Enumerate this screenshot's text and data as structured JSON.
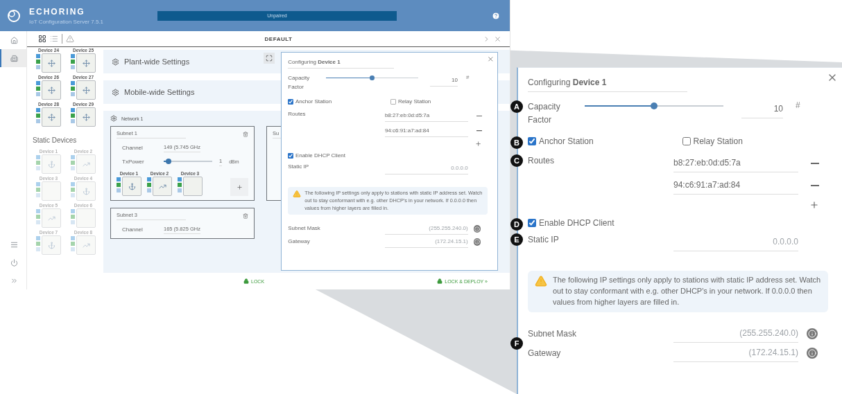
{
  "header": {
    "brand": "ECHORING",
    "subtitle": "IoT Configuration Server 7.5.1",
    "status": "Unpaired"
  },
  "nav": {
    "top": [
      {
        "kind": "home",
        "selected": false
      },
      {
        "kind": "building",
        "selected": true
      }
    ],
    "bottom": [
      {
        "kind": "list"
      },
      {
        "kind": "power"
      },
      {
        "kind": "expand"
      }
    ]
  },
  "toolbar": {
    "views": [
      {
        "kind": "grid",
        "selected": true
      },
      {
        "kind": "list",
        "selected": false
      }
    ],
    "title": "DEFAULT"
  },
  "palette": {
    "devices": [
      {
        "name": "Device 24",
        "kind": "move"
      },
      {
        "name": "Device 25",
        "kind": "move"
      },
      {
        "name": "Device 26",
        "kind": "move"
      },
      {
        "name": "Device 27",
        "kind": "move"
      },
      {
        "name": "Device 28",
        "kind": "move"
      },
      {
        "name": "Device 29",
        "kind": "move"
      }
    ],
    "static_title": "Static Devices",
    "static_devices": [
      {
        "name": "Device 1",
        "kind": "anchor"
      },
      {
        "name": "Device 2",
        "kind": "chart"
      },
      {
        "name": "Device 3",
        "kind": "empty"
      },
      {
        "name": "Device 4",
        "kind": "anchor"
      },
      {
        "name": "Device 5",
        "kind": "chart"
      },
      {
        "name": "Device 6",
        "kind": "empty"
      },
      {
        "name": "Device 7",
        "kind": "anchor"
      },
      {
        "name": "Device 8",
        "kind": "chart"
      }
    ]
  },
  "settings": [
    {
      "title": "Plant-wide Settings"
    },
    {
      "title": "Mobile-wide Settings"
    }
  ],
  "network": {
    "title": "Network 1",
    "subnets": [
      {
        "title": "Subnet 1",
        "channel_label": "Channel",
        "channel": "149 (5.745 GHz",
        "tx_label": "TxPower",
        "level": 0.1,
        "tx_value": "1",
        "tx_unit": "dBm",
        "devices": [
          {
            "name": "Device 1",
            "kind": "anchor"
          },
          {
            "name": "Device 2",
            "kind": "chart"
          },
          {
            "name": "Device 3",
            "kind": "empty"
          }
        ]
      },
      {
        "title": "Su"
      },
      {
        "title": "Subnet 3",
        "channel_label": "Channel",
        "channel": "165 (5.825 GHz"
      }
    ]
  },
  "footer": {
    "lock": "LOCK",
    "deploy": "LOCK & DEPLOY »"
  },
  "mini_dialog": {
    "title": "Configuring **Device 1**",
    "rows": [
      {
        "kind": "slider",
        "label": "Capacity Factor",
        "level": 0.5,
        "value": "10",
        "unit": "#"
      },
      {
        "kind": "checks",
        "items": [
          {
            "label": "Anchor Station",
            "checked": true
          },
          {
            "label": "Relay Station",
            "checked": false
          }
        ]
      },
      {
        "kind": "routes",
        "label": "Routes",
        "items": [
          "b8:27:eb:0d:d5:7a",
          "94:c6:91:a7:ad:84"
        ]
      },
      {
        "kind": "check",
        "label": "Enable DHCP Client",
        "checked": true
      },
      {
        "kind": "field",
        "label": "Static IP",
        "placeholder": "0.0.0.0"
      },
      {
        "kind": "warning",
        "text": "The following IP settings only apply to stations with static IP address set. Watch out to stay conformant with e.g. other DHCP's in your network. If 0.0.0.0 then values from higher layers are filled in."
      },
      {
        "kind": "info_fields",
        "items": [
          {
            "label": "Subnet Mask",
            "placeholder": "(255.255.240.0)"
          },
          {
            "label": "Gateway",
            "placeholder": "(172.24.15.1)"
          }
        ]
      }
    ]
  },
  "callout": {
    "title": "Configuring **Device 1**",
    "rows": [
      {
        "kind": "slider",
        "label": "Capacity Factor",
        "level": 0.5,
        "value": "10",
        "unit": "#",
        "marker": "A"
      },
      {
        "kind": "checks",
        "marker": "B",
        "items": [
          {
            "label": "Anchor Station",
            "checked": true
          },
          {
            "label": "Relay Station",
            "checked": false
          }
        ]
      },
      {
        "kind": "routes",
        "label": "Routes",
        "marker": "C",
        "items": [
          "b8:27:eb:0d:d5:7a",
          "94:c6:91:a7:ad:84"
        ]
      },
      {
        "kind": "check",
        "label": "Enable DHCP Client",
        "checked": true,
        "marker": "D"
      },
      {
        "kind": "field",
        "label": "Static IP",
        "placeholder": "0.0.0.0",
        "marker": "E"
      },
      {
        "kind": "warning",
        "text": "The following IP settings only apply to stations with static IP address set. Watch out to stay conformant with e.g. other DHCP's in your network. If 0.0.0.0 then values from higher layers are filled in."
      },
      {
        "kind": "info_fields",
        "marker": "F",
        "items": [
          {
            "label": "Subnet Mask",
            "placeholder": "(255.255.240.0)"
          },
          {
            "label": "Gateway",
            "placeholder": "(172.24.15.1)"
          }
        ]
      }
    ]
  }
}
